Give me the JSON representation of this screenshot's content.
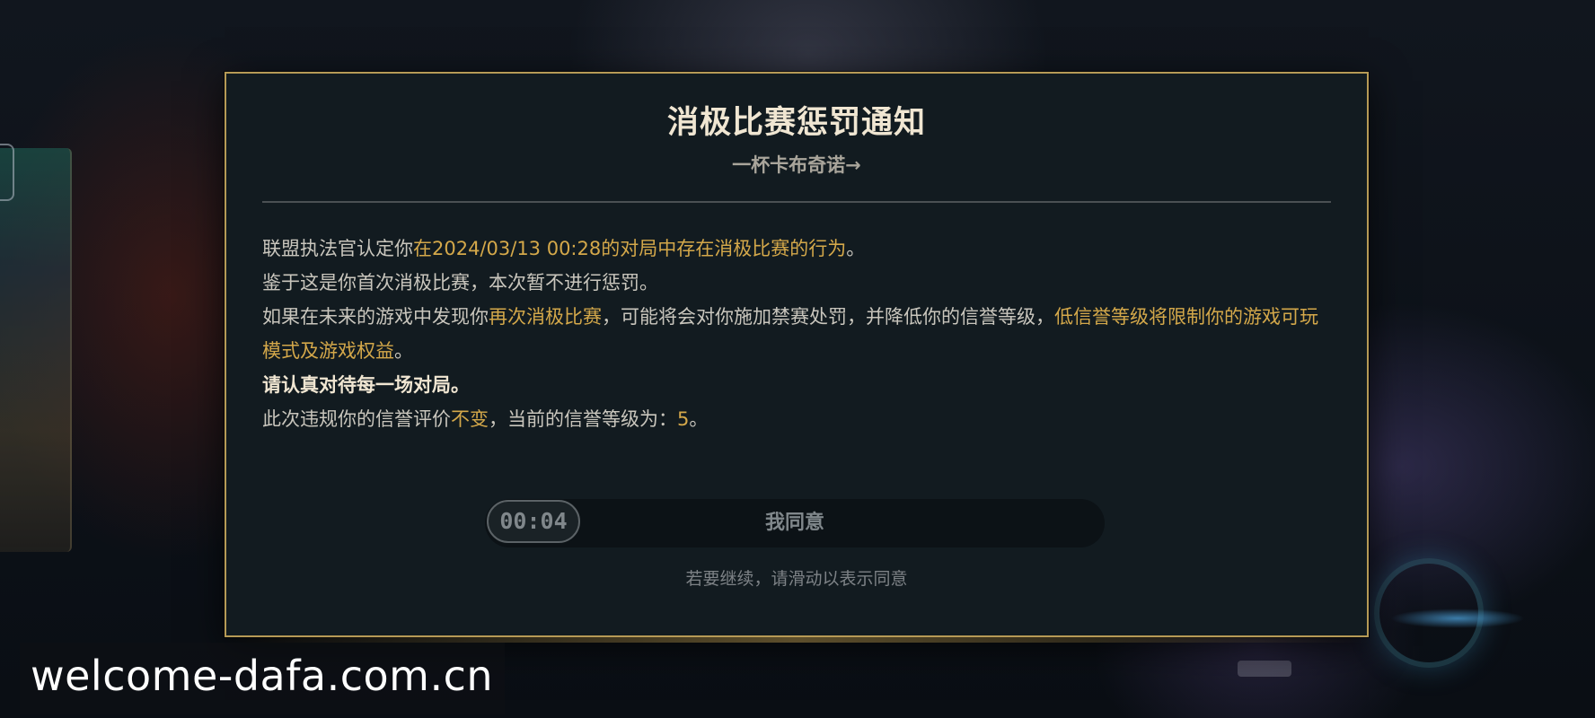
{
  "dialog": {
    "title": "消极比赛惩罚通知",
    "subtitle": "一杯卡布奇诺→",
    "lines": {
      "l1_a": "联盟执法官认定你",
      "l1_b": "在2024/03/13 00:28的对局中存在消极比赛的行为",
      "l1_c": "。",
      "l2": "鉴于这是你首次消极比赛，本次暂不进行惩罚。",
      "l3_a": "如果在未来的游戏中发现你",
      "l3_b": "再次消极比赛",
      "l3_c": "，可能将会对你施加禁赛处罚，并降低你的信誉等级，",
      "l3_d": "低信誉等级将限制你的游戏可玩模式及游戏权益",
      "l3_e": "。",
      "l4": "请认真对待每一场对局。",
      "l5_a": "此次违规你的信誉评价",
      "l5_b": "不变",
      "l5_c": "，当前的信誉等级为：",
      "l5_d": "5",
      "l5_e": "。"
    },
    "slider": {
      "timer": "00:04",
      "label": "我同意"
    },
    "hint": "若要继续，请滑动以表示同意"
  },
  "watermark": "welcome-dafa.com.cn",
  "colors": {
    "accent_gold": "#d4a84a",
    "border_gold": "#b69a56",
    "panel_bg": "#121b20"
  }
}
